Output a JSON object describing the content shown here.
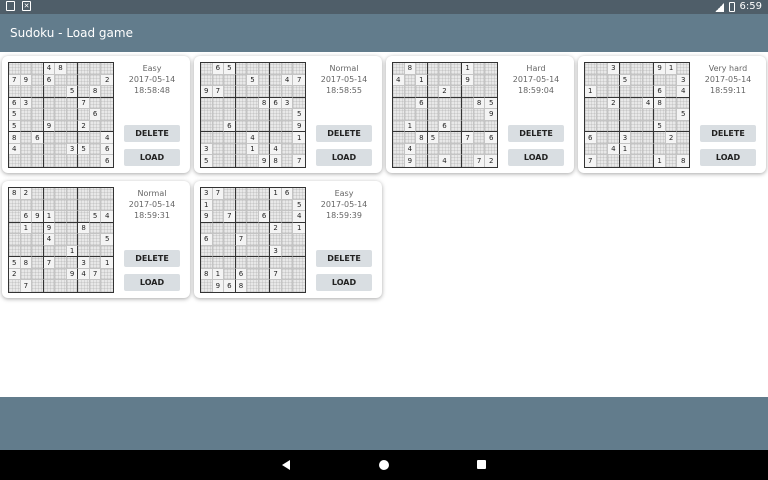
{
  "status_bar": {
    "time": "6:59"
  },
  "app_bar": {
    "title": "Sudoku - Load game"
  },
  "buttons": {
    "delete": "DELETE",
    "load": "LOAD"
  },
  "games": [
    {
      "difficulty": "Easy",
      "date": "2017-05-14",
      "time": "18:58:48",
      "grid": [
        "   48    ",
        "79 6    2",
        "     5 8 ",
        "63    7  ",
        "5      6 ",
        "5  9  2  ",
        "8 6     4",
        "4    35 6",
        "        6"
      ]
    },
    {
      "difficulty": "Normal",
      "date": "2017-05-14",
      "time": "18:58:55",
      "grid": [
        " 65      ",
        "    5  47",
        "97       ",
        "     863 ",
        "        5",
        "  6     9",
        "    4   1",
        "3   1 4  ",
        "5    98 7"
      ]
    },
    {
      "difficulty": "Hard",
      "date": "2017-05-14",
      "time": "18:59:04",
      "grid": [
        " 8    1  ",
        "4 1   9  ",
        "    2    ",
        "  6    85",
        "        9",
        " 1  6    ",
        "  85  7 6",
        " 4       ",
        " 9  4  72"
      ]
    },
    {
      "difficulty": "Very hard",
      "date": "2017-05-14",
      "time": "18:59:11",
      "grid": [
        "  3   91 ",
        "   5    3",
        "1     6 4",
        "  2  48  ",
        "        5",
        "      5  ",
        "6  3   2 ",
        "  41     ",
        "7     1 8"
      ]
    },
    {
      "difficulty": "Normal",
      "date": "2017-05-14",
      "time": "18:59:31",
      "grid": [
        "82       ",
        "         ",
        " 691   54",
        " 1 9  8  ",
        "   4    5",
        "     1   ",
        "58 7  3 1",
        "2    947 ",
        " 7       "
      ]
    },
    {
      "difficulty": "Easy",
      "date": "2017-05-14",
      "time": "18:59:39",
      "grid": [
        "37    16 ",
        "1       5",
        "9 7  6  4",
        "      2 1",
        "6  7     ",
        "      3  ",
        "         ",
        "81 6  7  ",
        " 968     "
      ]
    }
  ]
}
